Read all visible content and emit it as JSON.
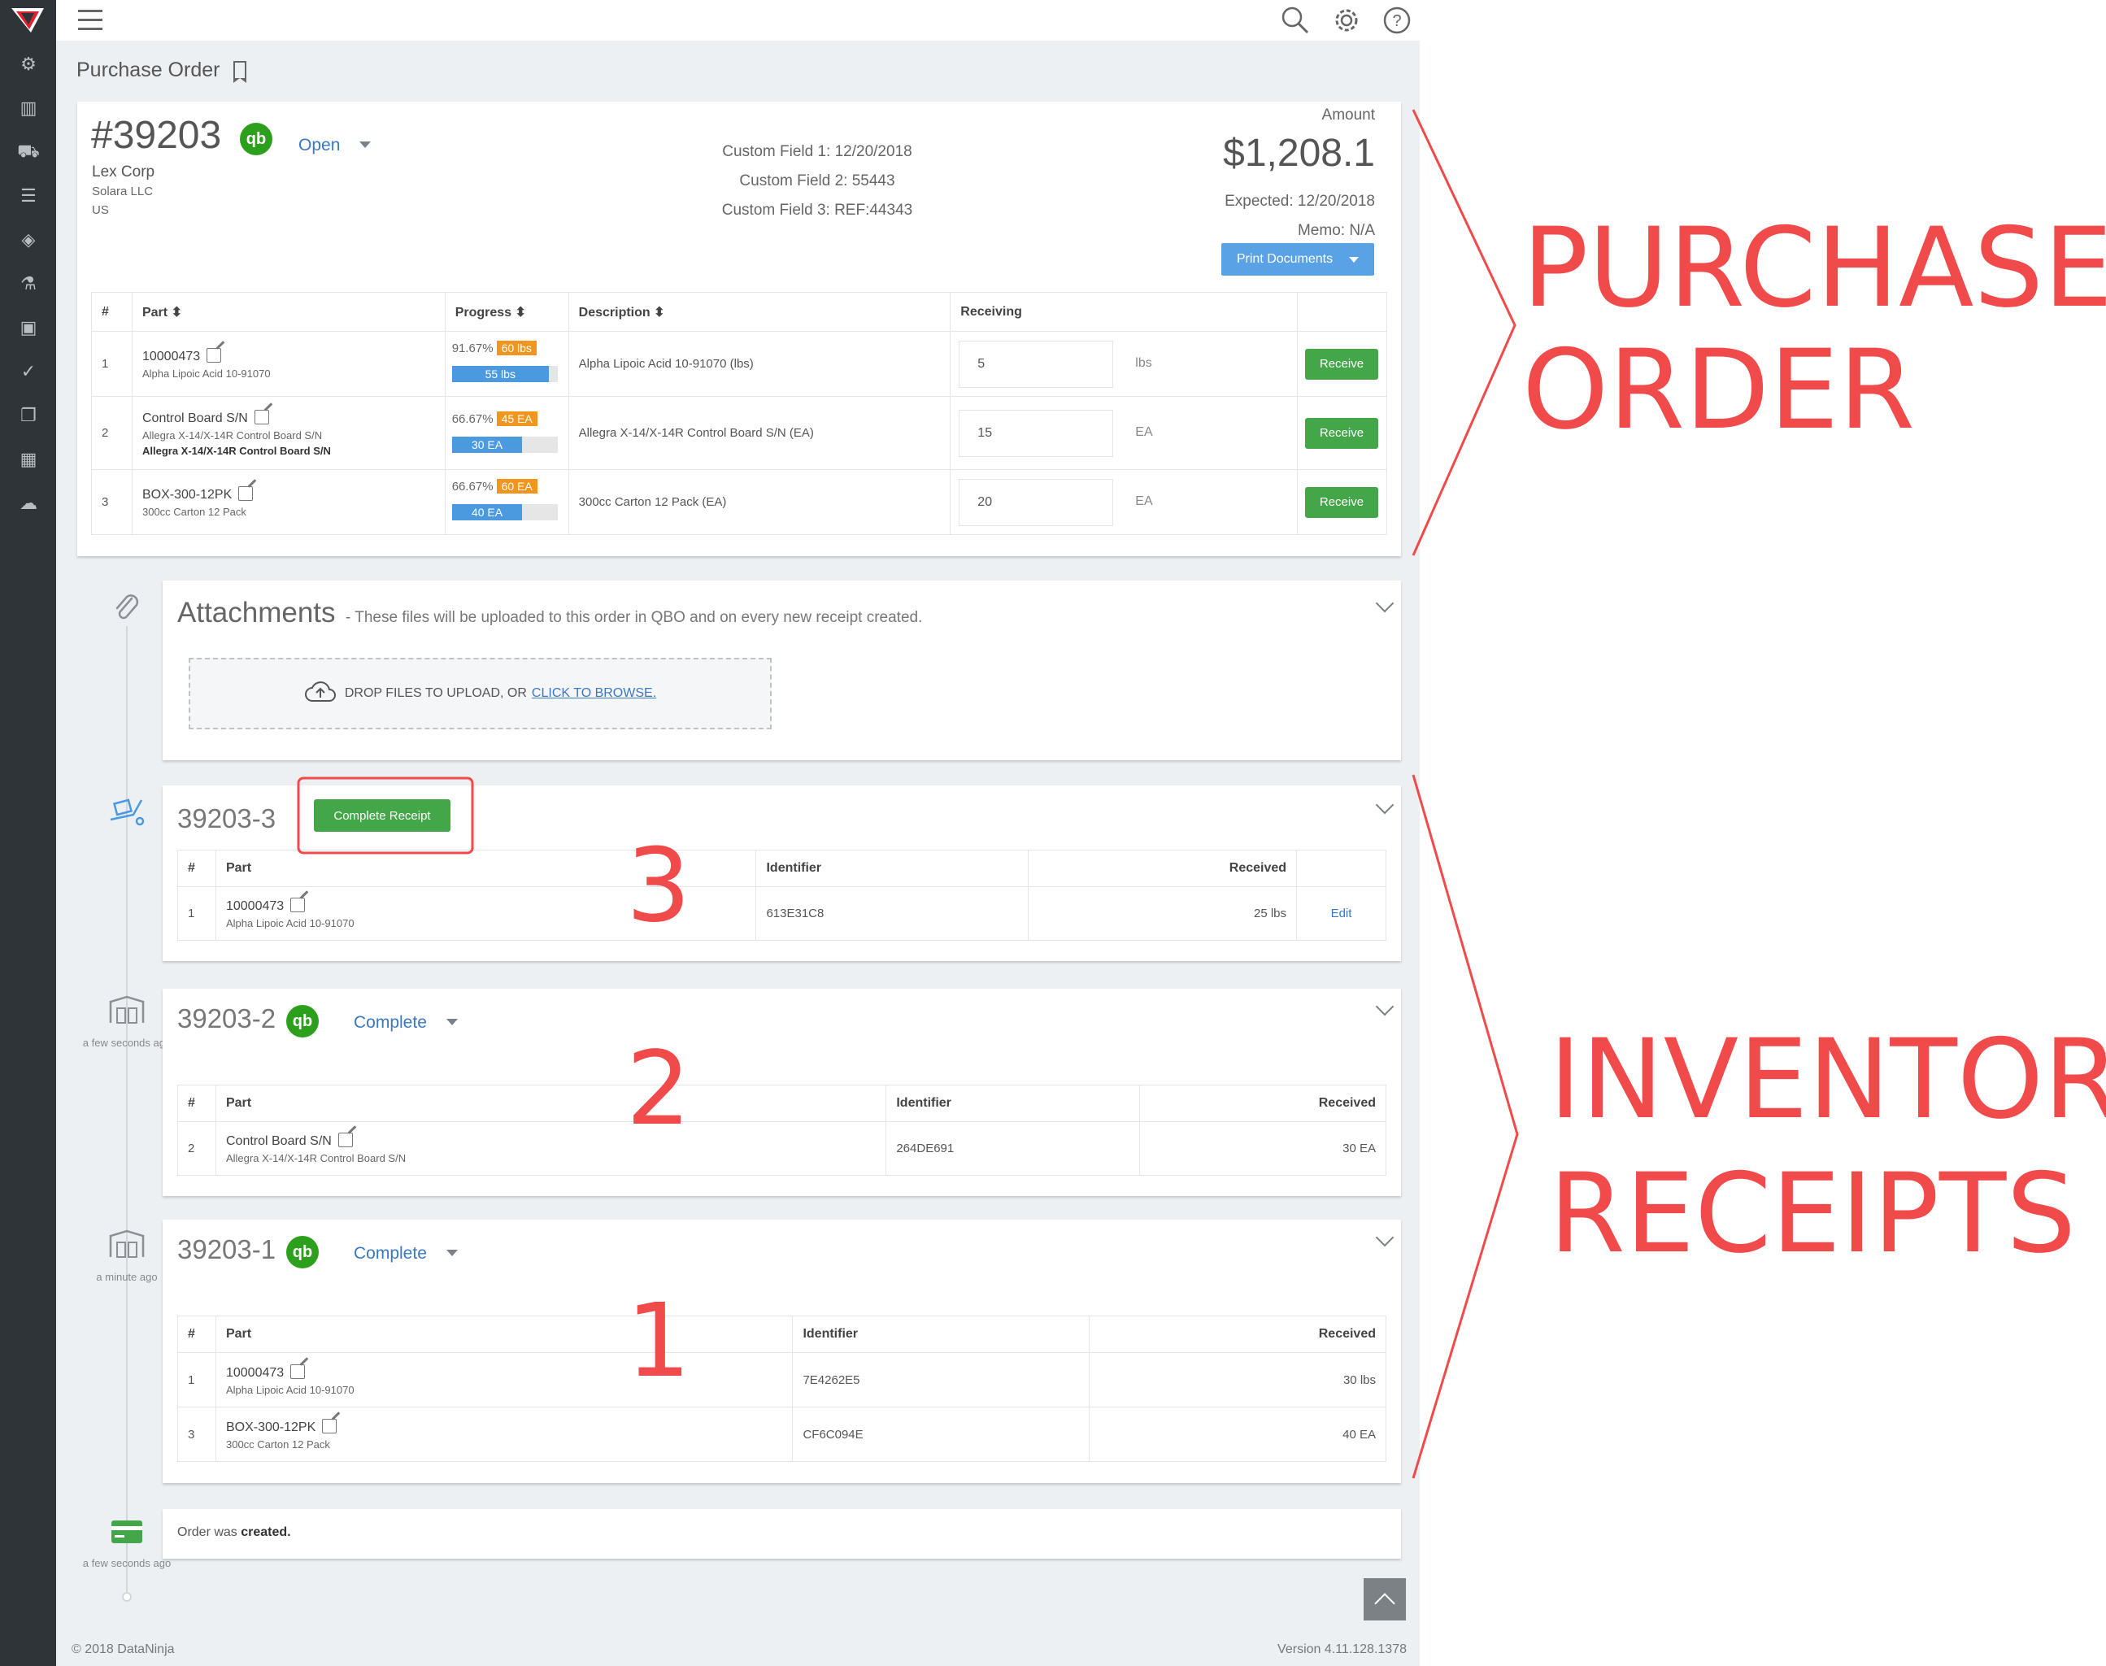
{
  "app": {
    "page_title": "Purchase Order",
    "footer_copyright": "© 2018 DataNinja",
    "footer_version": "Version 4.11.128.1378"
  },
  "order": {
    "number": "#39203",
    "qb_label": "qb",
    "status": "Open",
    "vendor": "Lex Corp",
    "address_line": "Solara LLC",
    "country": "US",
    "custom1": "Custom Field 1: 12/20/2018",
    "custom2": "Custom Field 2: 55443",
    "custom3": "Custom Field 3: REF:44343",
    "amount_label": "Amount",
    "amount": "$1,208.1",
    "expected": "Expected: 12/20/2018",
    "memo": "Memo: N/A",
    "print_label": "Print Documents"
  },
  "po_table": {
    "headers": {
      "num": "#",
      "part": "Part",
      "progress": "Progress",
      "description": "Description",
      "receiving": "Receiving"
    },
    "receive_label": "Receive",
    "rows": [
      {
        "num": "1",
        "code": "10000473",
        "desc": "Alpha Lipoic Acid 10-91070",
        "desc2": "",
        "pct": "91.67%",
        "badge": "60 lbs",
        "bar": "55 lbs",
        "fill": 0.9167,
        "description": "Alpha Lipoic Acid 10-91070 (lbs)",
        "qty": "5",
        "unit": "lbs"
      },
      {
        "num": "2",
        "code": "Control Board S/N",
        "desc": "Allegra X-14/X-14R Control Board S/N",
        "desc2": "Allegra X-14/X-14R Control Board S/N",
        "pct": "66.67%",
        "badge": "45 EA",
        "bar": "30 EA",
        "fill": 0.6667,
        "description": "Allegra X-14/X-14R Control Board S/N (EA)",
        "qty": "15",
        "unit": "EA"
      },
      {
        "num": "3",
        "code": "BOX-300-12PK",
        "desc": "300cc Carton 12 Pack",
        "desc2": "",
        "pct": "66.67%",
        "badge": "60 EA",
        "bar": "40 EA",
        "fill": 0.6667,
        "description": "300cc Carton 12 Pack (EA)",
        "qty": "20",
        "unit": "EA"
      }
    ]
  },
  "attachments": {
    "title": "Attachments",
    "subtitle": "- These files will be uploaded to this order in QBO and on every new receipt created.",
    "drop_text": "DROP FILES TO UPLOAD, OR",
    "browse_link": "CLICK TO BROWSE."
  },
  "receipt3": {
    "title": "39203-3",
    "complete_button": "Complete Receipt",
    "headers": {
      "num": "#",
      "part": "Part",
      "identifier": "Identifier",
      "received": "Received"
    },
    "rows": [
      {
        "num": "1",
        "code": "10000473",
        "desc": "Alpha Lipoic Acid 10-91070",
        "identifier": "613E31C8",
        "received": "25 lbs",
        "action": "Edit"
      }
    ]
  },
  "receipt2": {
    "title": "39203-2",
    "status": "Complete",
    "timestamp": "a few seconds ago",
    "headers": {
      "num": "#",
      "part": "Part",
      "identifier": "Identifier",
      "received": "Received"
    },
    "rows": [
      {
        "num": "2",
        "code": "Control Board S/N",
        "desc": "Allegra X-14/X-14R Control Board S/N",
        "identifier": "264DE691",
        "received": "30 EA"
      }
    ]
  },
  "receipt1": {
    "title": "39203-1",
    "status": "Complete",
    "timestamp": "a minute ago",
    "headers": {
      "num": "#",
      "part": "Part",
      "identifier": "Identifier",
      "received": "Received"
    },
    "rows": [
      {
        "num": "1",
        "code": "10000473",
        "desc": "Alpha Lipoic Acid 10-91070",
        "identifier": "7E4262E5",
        "received": "30 lbs"
      },
      {
        "num": "3",
        "code": "BOX-300-12PK",
        "desc": "300cc Carton 12 Pack",
        "identifier": "CF6C094E",
        "received": "40 EA"
      }
    ]
  },
  "created_event": {
    "text": "Order was",
    "bold": "created.",
    "timestamp": "a few seconds ago"
  },
  "annotations": {
    "purchase_line1": "PURCHASE",
    "purchase_line2": "ORDER",
    "inventory_line1": "INVENTORY",
    "inventory_line2": "RECEIPTS",
    "n3": "3",
    "n2": "2",
    "n1": "1",
    "red": "#f04a4a"
  },
  "colors": {
    "sidebar": "#2f3438",
    "accent_green": "#43a74a",
    "accent_blue": "#4b9ae0",
    "badge_orange": "#f0951e",
    "qb_green": "#2ca01c",
    "link_blue": "#3b78c2"
  }
}
